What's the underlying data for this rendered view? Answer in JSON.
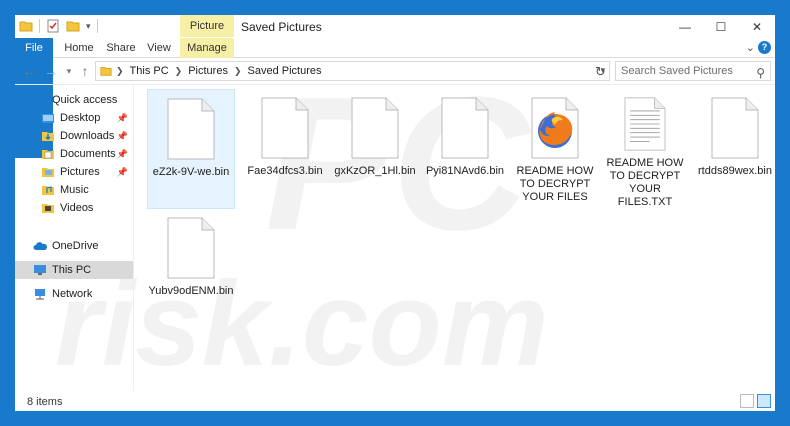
{
  "window": {
    "title": "Saved Pictures",
    "contextual_tab_group": "Picture Tools"
  },
  "ribbon": {
    "tabs": [
      "File",
      "Home",
      "Share",
      "View",
      "Manage"
    ]
  },
  "address": {
    "crumbs": [
      "This PC",
      "Pictures",
      "Saved Pictures"
    ]
  },
  "search": {
    "placeholder": "Search Saved Pictures"
  },
  "sidebar": {
    "items": [
      {
        "label": "Quick access",
        "icon": "star-icon"
      },
      {
        "label": "Desktop",
        "icon": "desktop-folder-icon"
      },
      {
        "label": "Downloads",
        "icon": "downloads-folder-icon"
      },
      {
        "label": "Documents",
        "icon": "documents-folder-icon"
      },
      {
        "label": "Pictures",
        "icon": "pictures-folder-icon"
      },
      {
        "label": "Music",
        "icon": "music-folder-icon"
      },
      {
        "label": "Videos",
        "icon": "videos-folder-icon"
      },
      {
        "label": "OneDrive",
        "icon": "onedrive-icon"
      },
      {
        "label": "This PC",
        "icon": "computer-icon"
      },
      {
        "label": "Network",
        "icon": "network-icon"
      }
    ]
  },
  "files": [
    {
      "name": "eZ2k-9V-we.bin",
      "type": "blank",
      "selected": true
    },
    {
      "name": "Fae34dfcs3.bin",
      "type": "blank"
    },
    {
      "name": "gxKzOR_1Hl.bin",
      "type": "blank"
    },
    {
      "name": "Pyi81NAvd6.bin",
      "type": "blank"
    },
    {
      "name": "README HOW TO DECRYPT YOUR FILES",
      "type": "firefox"
    },
    {
      "name": "README HOW TO DECRYPT YOUR FILES.TXT",
      "type": "text"
    },
    {
      "name": "rtdds89wex.bin",
      "type": "blank"
    },
    {
      "name": "Yubv9odENM.bin",
      "type": "blank"
    }
  ],
  "status": {
    "item_count": "8 items"
  },
  "watermark": {
    "text1": "PC",
    "text2": "risk.com"
  }
}
